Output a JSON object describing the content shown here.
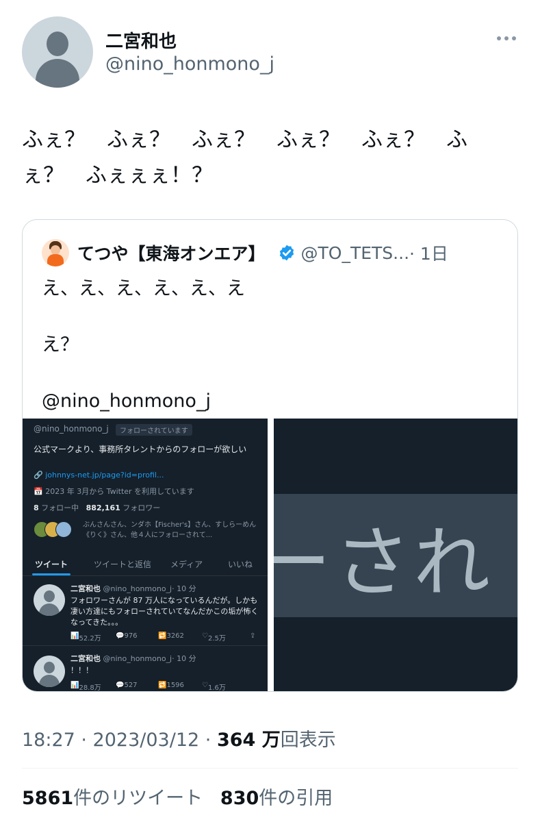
{
  "author": {
    "name": "二宮和也",
    "handle": "@nino_honmono_j"
  },
  "tweet": {
    "text": "ふぇ？　ふぇ？　ふぇ？　ふぇ？　ふぇ？　ふ\nぇ？　ふぇぇぇ！？"
  },
  "quoted": {
    "name": "てつや【東海オンエア】",
    "handle": "@TO_TETS...",
    "time": "· 1日",
    "text": "え、え、え、え、え、え\n\nえ？\n\n@nino_honmono_j",
    "verified_color": "#1d9bf0"
  },
  "screenshot": {
    "handle": "@nino_honmono_j",
    "follows_badge": "フォローされています",
    "bio": "公式マークより、事務所タレントからのフォローが欲しい",
    "link": "johnnys-net.jp/page?id=profil...",
    "joined": "2023 年 3月から Twitter を利用しています",
    "following_count": "8",
    "following_label": "フォロー中",
    "followers_count": "882,161",
    "followers_label": "フォロワー",
    "known_followers": "ぶんさんさん、ンダホ【Fischer's】さん、すしらーめん《りく》さん、他４人にフォローされて...",
    "tabs": [
      "ツイート",
      "ツイートと返信",
      "メディア",
      "いいね"
    ],
    "posts": [
      {
        "name": "二宮和也",
        "handle": "@nino_honmono_j",
        "time": "· 10 分",
        "text": "フォロワーさんが 87 万人になっているんだが。しかも凄い方達にもフォローされていてなんだかこの垢が怖くなってきた。。。",
        "views": "52.2万",
        "replies": "976",
        "retweets": "3262",
        "likes": "2.5万"
      },
      {
        "name": "二宮和也",
        "handle": "@nino_honmono_j",
        "time": "· 10 分",
        "text": "！！！",
        "views": "28.8万",
        "replies": "527",
        "retweets": "1596",
        "likes": "1.6万"
      }
    ],
    "zoom_text": "ーされ"
  },
  "meta": {
    "time": "18:27 · 2023/03/12 · ",
    "views_count": "364 万",
    "views_label": "回表示"
  },
  "counts": {
    "retweets": "5861",
    "retweets_label": "件のリツイート",
    "quotes": "830",
    "quotes_label": "件の引用"
  }
}
